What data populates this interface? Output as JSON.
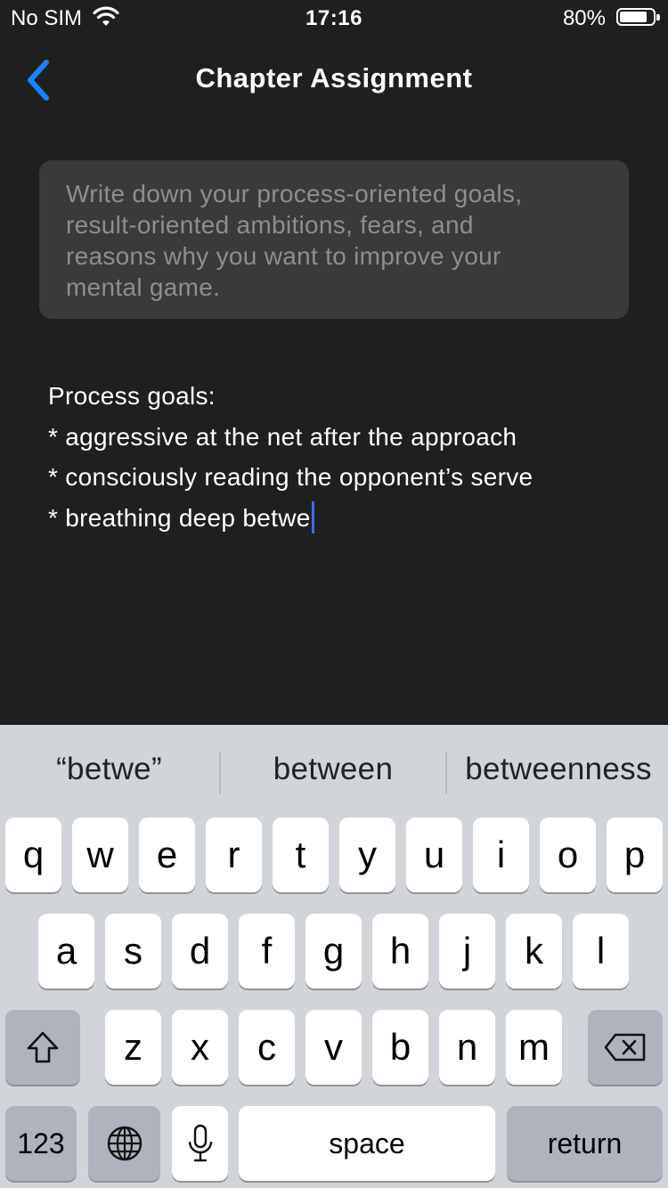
{
  "status_bar": {
    "carrier": "No SIM",
    "time": "17:16",
    "battery_percent": "80%",
    "battery_level": 0.8
  },
  "nav": {
    "back_icon": "chevron-left-icon",
    "title": "Chapter Assignment",
    "accent_color": "#1a82fb"
  },
  "prompt": {
    "lines": [
      "Write down your process-oriented goals,",
      "result-oriented ambitions, fears, and",
      "reasons why you want to improve your",
      "mental game."
    ]
  },
  "editor": {
    "lines": [
      "Process goals:",
      "* aggressive at the net after the approach",
      "* consciously reading the opponent’s serve",
      "* breathing deep betwe"
    ],
    "caret_color": "#3b6ff7"
  },
  "keyboard": {
    "suggestions": [
      "“betwe”",
      "between",
      "betweenness"
    ],
    "row1": [
      "q",
      "w",
      "e",
      "r",
      "t",
      "y",
      "u",
      "i",
      "o",
      "p"
    ],
    "row2": [
      "a",
      "s",
      "d",
      "f",
      "g",
      "h",
      "j",
      "k",
      "l"
    ],
    "row3": [
      "z",
      "x",
      "c",
      "v",
      "b",
      "n",
      "m"
    ],
    "numbers_label": "123",
    "space_label": "space",
    "return_label": "return",
    "shift_icon": "shift-icon",
    "delete_icon": "delete-icon",
    "globe_icon": "globe-icon",
    "mic_icon": "microphone-icon"
  }
}
